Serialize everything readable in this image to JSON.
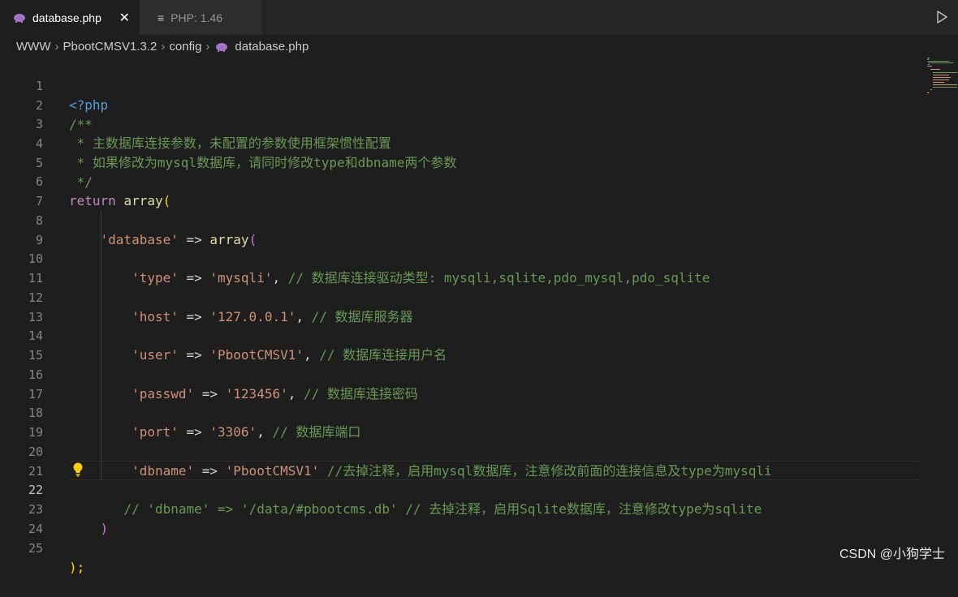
{
  "tabs": [
    {
      "label": "database.php",
      "icon": "php-elephant-icon",
      "active": true
    },
    {
      "label": "PHP: 1.46",
      "icon": "output-icon",
      "active": false
    }
  ],
  "breadcrumb": [
    "WWW",
    "PbootCMSV1.3.2",
    "config",
    "database.php"
  ],
  "lines": {
    "1": [
      "<?php"
    ],
    "2": [
      "/**"
    ],
    "3": [
      " * 主数据库连接参数，未配置的参数使用框架惯性配置"
    ],
    "4": [
      " * 如果修改为mysql数据库，请同时修改type和dbname两个参数"
    ],
    "5": [
      " */"
    ],
    "6": [
      "return",
      " ",
      "array",
      "("
    ],
    "8": [
      "    ",
      "'database'",
      " => ",
      "array",
      "("
    ],
    "10": [
      "        ",
      "'type'",
      " => ",
      "'mysqli'",
      ", ",
      "// 数据库连接驱动类型: mysqli,sqlite,pdo_mysql,pdo_sqlite"
    ],
    "12": [
      "        ",
      "'host'",
      " => ",
      "'127.0.0.1'",
      ", ",
      "// 数据库服务器"
    ],
    "14": [
      "        ",
      "'user'",
      " => ",
      "'PbootCMSV1'",
      ", ",
      "// 数据库连接用户名"
    ],
    "16": [
      "        ",
      "'passwd'",
      " => ",
      "'123456'",
      ", ",
      "// 数据库连接密码"
    ],
    "18": [
      "        ",
      "'port'",
      " => ",
      "'3306'",
      ", ",
      "// 数据库端口"
    ],
    "20": [
      "        ",
      "'dbname'",
      " => ",
      "'PbootCMSV1'",
      " ",
      "//去掉注释，启用mysql数据库，注意修改前面的连接信息及type为mysqli"
    ],
    "22": [
      "       ",
      "// 'dbname' => '/data/#pbootcms.db' // 去掉注释，启用Sqlite数据库，注意修改type为sqlite"
    ],
    "23": [
      "    ",
      ")"
    ],
    "25": [
      ");"
    ]
  },
  "line_numbers": [
    "1",
    "2",
    "3",
    "4",
    "5",
    "6",
    "7",
    "8",
    "9",
    "10",
    "11",
    "12",
    "13",
    "14",
    "15",
    "16",
    "17",
    "18",
    "19",
    "20",
    "21",
    "22",
    "23",
    "24",
    "25"
  ],
  "current_line": 22,
  "watermark": "CSDN @小狗学士",
  "colors": {
    "background": "#1e1e1e",
    "keyword": "#569cd6",
    "control": "#c586c0",
    "function": "#dcdcaa",
    "string": "#ce9178",
    "comment": "#6a9955",
    "bracket_gold": "#ffd700",
    "bracket_purple": "#da70d6"
  }
}
